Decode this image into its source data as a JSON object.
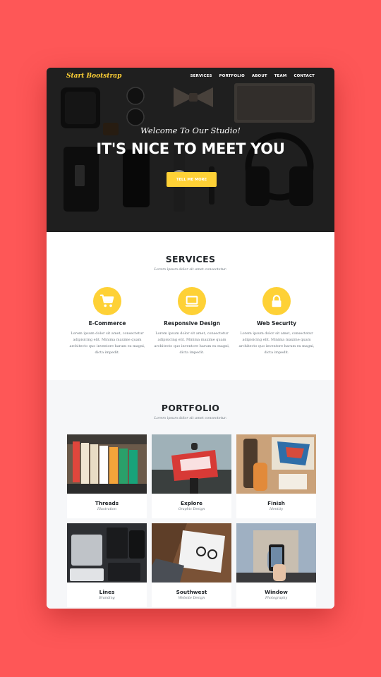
{
  "nav": {
    "brand": "Start Bootstrap",
    "items": [
      "SERVICES",
      "PORTFOLIO",
      "ABOUT",
      "TEAM",
      "CONTACT"
    ]
  },
  "hero": {
    "lead": "Welcome To Our Studio!",
    "heading": "IT'S NICE TO MEET YOU",
    "button": "TELL ME MORE"
  },
  "services": {
    "title": "SERVICES",
    "subtitle": "Lorem ipsum dolor sit amet consectetur.",
    "items": [
      {
        "icon": "shopping-cart-icon",
        "title": "E-Commerce",
        "text": "Lorem ipsum dolor sit amet, consectetur adipisicing elit. Minima maxime quam architecto quo inventore harum ex magni, dicta impedit."
      },
      {
        "icon": "laptop-icon",
        "title": "Responsive Design",
        "text": "Lorem ipsum dolor sit amet, consectetur adipisicing elit. Minima maxime quam architecto quo inventore harum ex magni, dicta impedit."
      },
      {
        "icon": "lock-icon",
        "title": "Web Security",
        "text": "Lorem ipsum dolor sit amet, consectetur adipisicing elit. Minima maxime quam architecto quo inventore harum ex magni, dicta impedit."
      }
    ]
  },
  "portfolio": {
    "title": "PORTFOLIO",
    "subtitle": "Lorem ipsum dolor sit amet consectetur.",
    "items": [
      {
        "name": "Threads",
        "category": "Illustration"
      },
      {
        "name": "Explore",
        "category": "Graphic Design"
      },
      {
        "name": "Finish",
        "category": "Identity"
      },
      {
        "name": "Lines",
        "category": "Branding"
      },
      {
        "name": "Southwest",
        "category": "Website Design"
      },
      {
        "name": "Window",
        "category": "Photography"
      }
    ]
  },
  "colors": {
    "page_background": "#fe5757",
    "accent": "#fed136",
    "hero_dark": "#2c2c2c",
    "portfolio_background": "#f6f7f9"
  }
}
